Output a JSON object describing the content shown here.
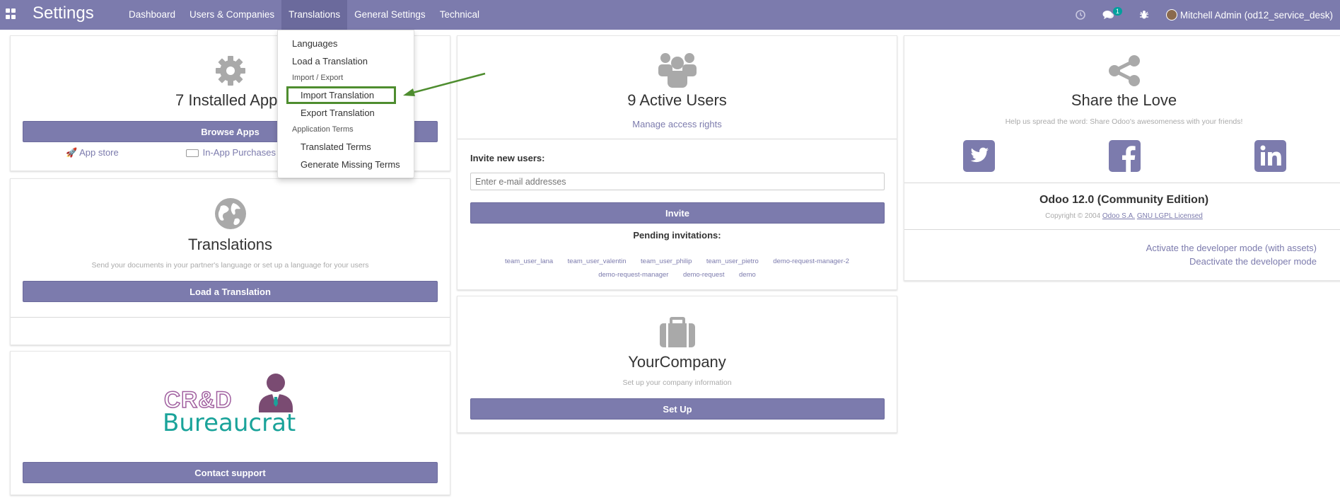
{
  "navbar": {
    "title": "Settings",
    "menu": [
      "Dashboard",
      "Users & Companies",
      "Translations",
      "General Settings",
      "Technical"
    ],
    "chat_badge": "1",
    "user": "Mitchell Admin (od12_service_desk)"
  },
  "dropdown": {
    "languages": "Languages",
    "load_translation": "Load a Translation",
    "import_export_header": "Import / Export",
    "import_translation": "Import Translation",
    "export_translation": "Export Translation",
    "app_terms_header": "Application Terms",
    "translated_terms": "Translated Terms",
    "generate_missing_terms": "Generate Missing Terms"
  },
  "apps_card": {
    "title": "7 Installed Apps",
    "button": "Browse Apps",
    "app_store": "App store",
    "in_app_purchases": "In-App Purchases"
  },
  "translations_card": {
    "title": "Translations",
    "subtitle": "Send your documents in your partner's language or set up a language for your users",
    "button": "Load a Translation"
  },
  "support_card": {
    "logo_top": "CR&D",
    "logo_bottom": "Bureaucrat",
    "button": "Contact support"
  },
  "users_card": {
    "title": "9 Active Users",
    "manage_link": "Manage access rights",
    "invite_label": "Invite new users:",
    "email_placeholder": "Enter e-mail addresses",
    "invite_button": "Invite",
    "pending_title": "Pending invitations:",
    "pending_row1": [
      "team_user_lana",
      "team_user_valentin",
      "team_user_philip",
      "team_user_pietro",
      "demo-request-manager-2"
    ],
    "pending_row2": [
      "demo-request-manager",
      "demo-request",
      "demo"
    ]
  },
  "company_card": {
    "title": "YourCompany",
    "subtitle": "Set up your company information",
    "button": "Set Up"
  },
  "share_card": {
    "title": "Share the Love",
    "subtitle": "Help us spread the word: Share Odoo's awesomeness with your friends!",
    "edition": "Odoo 12.0 (Community Edition)",
    "copyright_prefix": "Copyright © 2004",
    "copyright_company": "Odoo S.A.",
    "copyright_license": "GNU LGPL Licensed",
    "dev_mode_assets": "Activate the developer mode (with assets)",
    "dev_mode_deactivate": "Deactivate the developer mode"
  },
  "colors": {
    "brand": "#7c7bad",
    "highlight": "#4e8d2f",
    "teal": "#00a09d"
  }
}
